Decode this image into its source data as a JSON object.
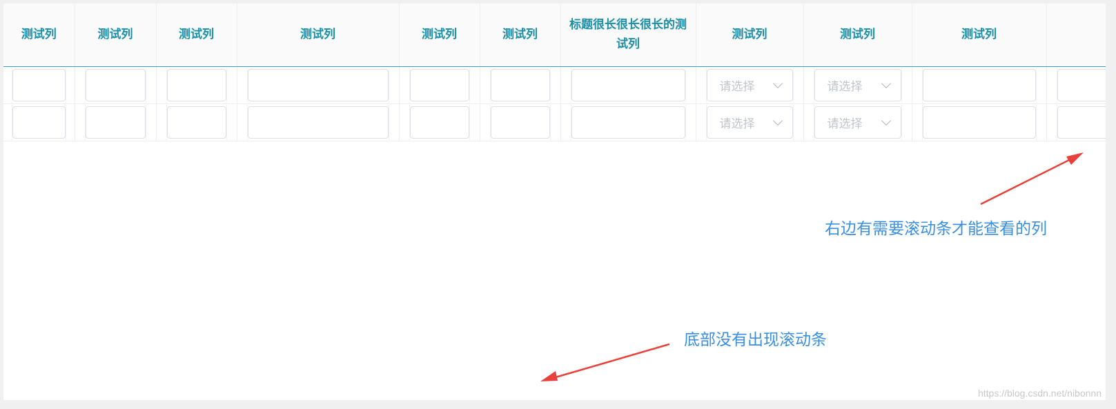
{
  "table": {
    "columns": [
      {
        "label": "测试列",
        "type": "input"
      },
      {
        "label": "测试列",
        "type": "input"
      },
      {
        "label": "测试列",
        "type": "input"
      },
      {
        "label": "测试列",
        "type": "input"
      },
      {
        "label": "测试列",
        "type": "input"
      },
      {
        "label": "测试列",
        "type": "input"
      },
      {
        "label": "标题很长很长很长的测试列",
        "type": "input"
      },
      {
        "label": "测试列",
        "type": "select"
      },
      {
        "label": "测试列",
        "type": "select"
      },
      {
        "label": "测试列",
        "type": "input"
      },
      {
        "label": "",
        "type": "input"
      }
    ],
    "rows": [
      {
        "select_placeholder": "请选择"
      },
      {
        "select_placeholder": "请选择"
      }
    ]
  },
  "annotations": {
    "right_note": "右边有需要滚动条才能查看的列",
    "bottom_note": "底部没有出现滚动条"
  },
  "watermark": "https://blog.csdn.net/nibonnn",
  "colors": {
    "header_text": "#1a8fa8",
    "annotation_text": "#3a8fe0",
    "arrow": "#e8403a",
    "placeholder": "#c0c4cc"
  }
}
